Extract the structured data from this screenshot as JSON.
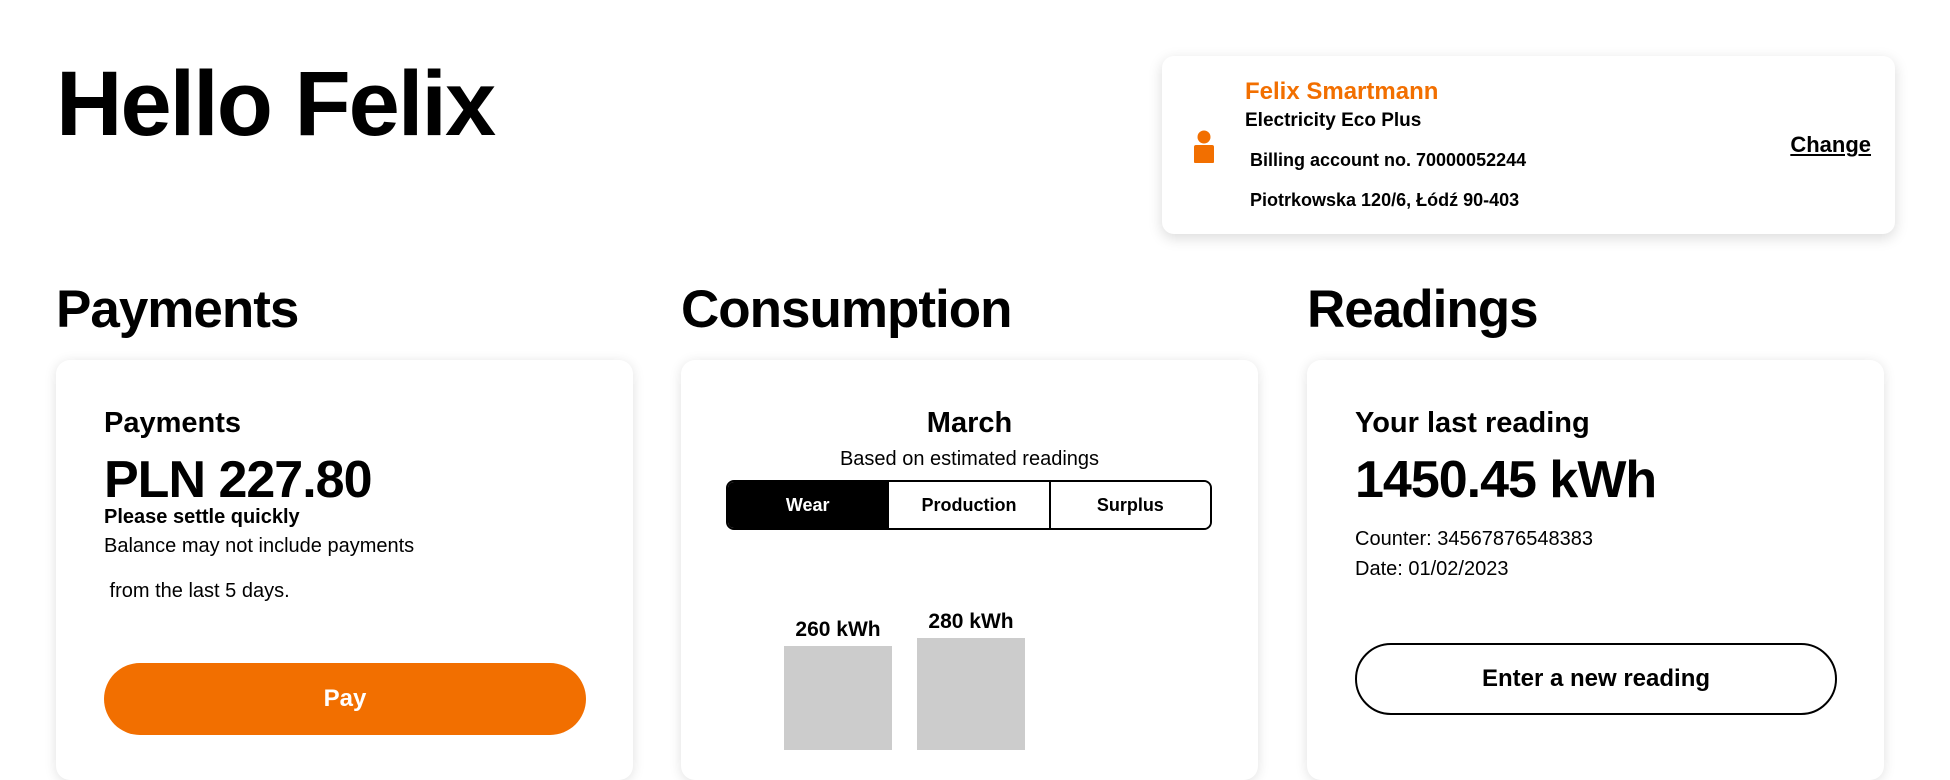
{
  "greeting": "Hello Felix",
  "account": {
    "name": "Felix Smartmann",
    "plan": "Electricity Eco Plus",
    "billing": "Billing account no. 70000052244",
    "address": "Piotrkowska 120/6, Łódź 90-403",
    "change_label": "Change",
    "icon": "person-icon",
    "accent_color": "#f26f00"
  },
  "payments": {
    "section_title": "Payments",
    "title": "Payments",
    "amount": "PLN 227.80",
    "warning": "Please settle quickly",
    "note_line1": "Balance may not include payments",
    "note_line2": " from the last 5 days.",
    "button_label": "Pay",
    "button_color": "#f26f00"
  },
  "consumption": {
    "section_title": "Consumption",
    "month": "March",
    "subtitle": "Based on estimated readings",
    "tabs": [
      {
        "label": "Wear",
        "active": true
      },
      {
        "label": "Production",
        "active": false
      },
      {
        "label": "Surplus",
        "active": false
      }
    ]
  },
  "readings": {
    "section_title": "Readings",
    "title": "Your last reading",
    "value": "1450.45 kWh",
    "counter": "Counter: 34567876548383",
    "date": "Date: 01/02/2023",
    "button_label": "Enter a new reading"
  },
  "chart_data": {
    "type": "bar",
    "categories": [
      "",
      ""
    ],
    "values": [
      260,
      280
    ],
    "labels": [
      "260 kWh",
      "280 kWh"
    ],
    "bar_color": "#cccccc",
    "title": "",
    "xlabel": "",
    "ylabel": ""
  }
}
